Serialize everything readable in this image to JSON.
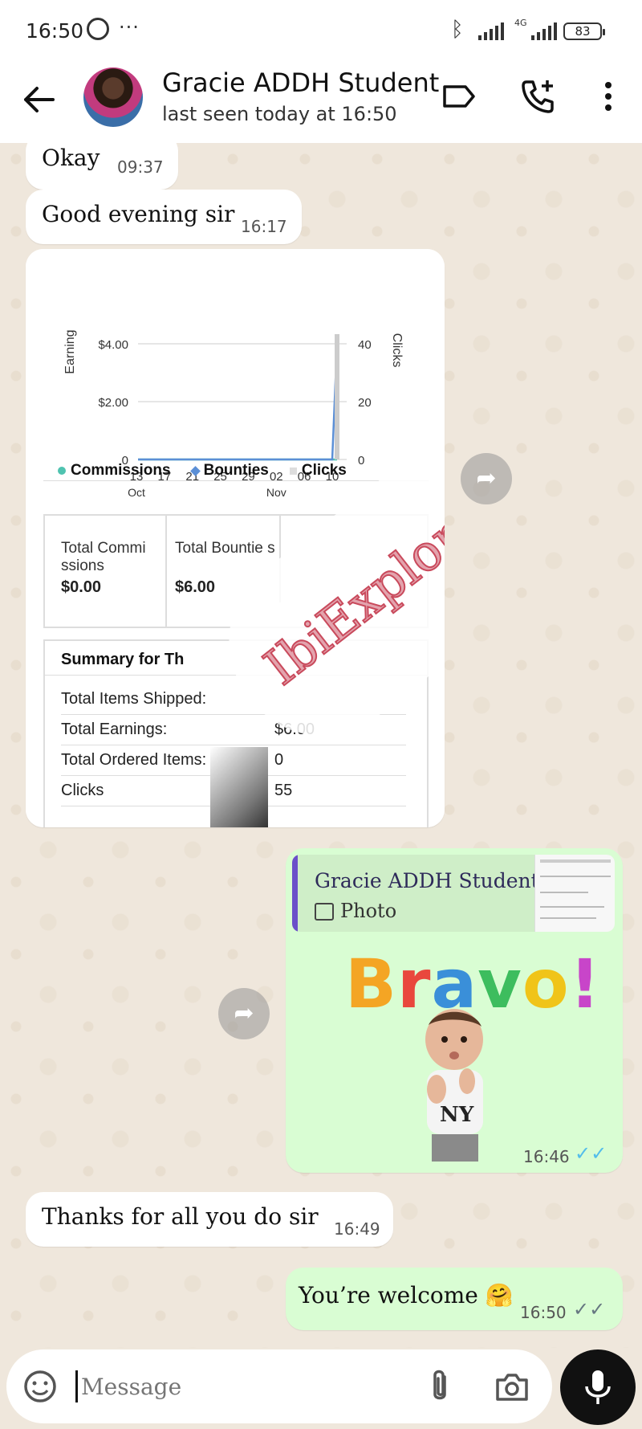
{
  "status_bar": {
    "time": "16:50",
    "battery": "83",
    "network": "4G"
  },
  "header": {
    "contact_name": "Gracie ADDH Student",
    "last_seen": "last seen today at 16:50"
  },
  "messages": {
    "okay": {
      "text": "Okay",
      "time": "09:37"
    },
    "evening": {
      "text": "Good evening sir",
      "time": "16:17"
    },
    "thanks": {
      "text": "Thanks for all you do sir",
      "time": "16:49"
    },
    "welcome": {
      "text": "You’re welcome 🤗",
      "time": "16:50"
    },
    "bravo": {
      "reply_name": "Gracie ADDH Student",
      "reply_type": "Photo",
      "sticker_text": "Bravo!",
      "sticker_shirt": "NY",
      "time": "16:46"
    }
  },
  "screenshot": {
    "left_axis_label": "Earning",
    "right_axis_label": "Clicks",
    "legend": [
      "Commissions",
      "Bounties",
      "Clicks"
    ],
    "total_commissions_label": "Total Commi ssions",
    "total_commissions_value": "$0.00",
    "total_bounties_label": "Total Bountie s",
    "total_bounties_value": "$6.00",
    "summary_title": "Summary for Th",
    "summary_rows": [
      {
        "label": "Total Items Shipped:",
        "value": ""
      },
      {
        "label": "Total Earnings:",
        "value": "$6.00"
      },
      {
        "label": "Total Ordered Items:",
        "value": "0"
      },
      {
        "label": "Clicks",
        "value": "55"
      }
    ]
  },
  "chart_data": {
    "type": "line",
    "x": [
      "13 Oct",
      "17",
      "21",
      "25",
      "29",
      "02 Nov",
      "06",
      "10"
    ],
    "x_tick_labels": [
      "13",
      "17",
      "21",
      "25",
      "29",
      "02",
      "06",
      "10"
    ],
    "x_month_labels": [
      "Oct",
      "Nov"
    ],
    "ylabel": "Earning",
    "y2label": "Clicks",
    "y_ticks": [
      "$4.00",
      "$2.00",
      "0"
    ],
    "y2_ticks": [
      "40",
      "20",
      "0"
    ],
    "ylim": [
      0,
      4
    ],
    "y2lim": [
      0,
      40
    ],
    "series": [
      {
        "name": "Commissions",
        "values": [
          0,
          0,
          0,
          0,
          0,
          0,
          0,
          0
        ],
        "color": "#4fc3b0"
      },
      {
        "name": "Bounties",
        "values": [
          0,
          0,
          0,
          0,
          0,
          0,
          0,
          6
        ],
        "color": "#5b8fd6"
      },
      {
        "name": "Clicks",
        "values": [
          0,
          0,
          0,
          0,
          0,
          0,
          0,
          55
        ],
        "color": "#cccccc"
      }
    ]
  },
  "watermark": "IbiExplorer",
  "input": {
    "placeholder": "Message"
  },
  "colors": {
    "incoming": "#ffffff",
    "outgoing": "#d9fdd3",
    "ticks_read": "#53bdeb",
    "ticks_sent": "#667781"
  }
}
